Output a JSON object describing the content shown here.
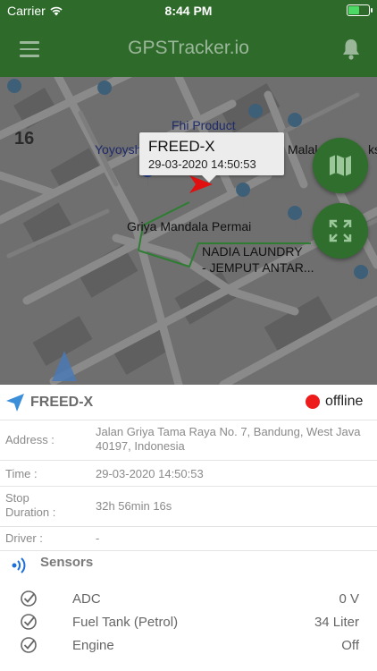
{
  "status_bar": {
    "carrier": "Carrier",
    "time": "8:44 PM"
  },
  "header": {
    "title": "GPSTracker.io",
    "menu_icon": "hamburger-menu-icon",
    "bell_icon": "bell-icon"
  },
  "map": {
    "zoom_label": "16",
    "places": [
      "Fhi Product",
      "Yoyoysh",
      "Malal",
      "ks",
      "Griya Mandala Permai",
      "NADIA LAUNDRY",
      "- JEMPUT ANTAR..."
    ],
    "popup": {
      "name": "FREED-X",
      "datetime": "29-03-2020 14:50:53"
    },
    "route_color": "#2e7d32",
    "marker_color": "#e01010"
  },
  "device": {
    "name": "FREED-X",
    "status": "offline",
    "status_color": "#ee1b1b"
  },
  "details": {
    "address_label": "Address :",
    "address_value": "Jalan Griya Tama Raya No. 7, Bandung, West Java 40197, Indonesia",
    "time_label": "Time :",
    "time_value": "29-03-2020 14:50:53",
    "stop_label": "Stop Duration :",
    "stop_value": "32h 56min 16s",
    "driver_label": "Driver :",
    "driver_value": "-"
  },
  "sensors": {
    "title": "Sensors",
    "items": [
      {
        "name": "ADC",
        "value": "0 V"
      },
      {
        "name": "Fuel Tank (Petrol)",
        "value": "34 Liter"
      },
      {
        "name": "Engine",
        "value": "Off"
      }
    ]
  }
}
